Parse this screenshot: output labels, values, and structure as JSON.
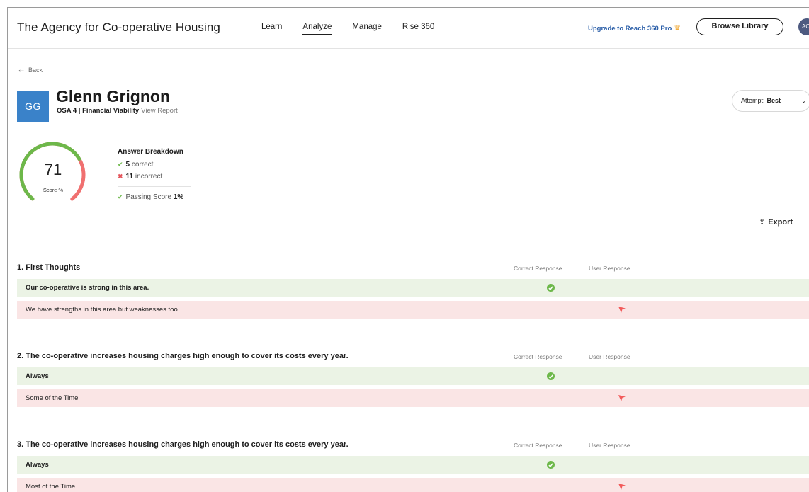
{
  "header": {
    "brand": "The Agency for Co-operative Housing",
    "nav": [
      "Learn",
      "Analyze",
      "Manage",
      "Rise 360"
    ],
    "active_nav": "Analyze",
    "upgrade": "Upgrade to Reach 360 Pro",
    "browse": "Browse Library",
    "avatar": "AC"
  },
  "back": "Back",
  "profile": {
    "initials": "GG",
    "name": "Glenn Grignon",
    "course": "OSA 4 | Financial Viability",
    "view_report": "View Report",
    "attempt_label": "Attempt:",
    "attempt_value": "Best"
  },
  "score": {
    "value": "71",
    "label": "Score %",
    "fraction": 0.71,
    "accent_green": "#6db84a",
    "accent_red": "#f07070"
  },
  "breakdown": {
    "title": "Answer Breakdown",
    "correct_count": "5",
    "correct_label": "correct",
    "incorrect_count": "11",
    "incorrect_label": "incorrect",
    "passing_label": "Passing Score",
    "passing_value": "1%"
  },
  "export": "Export",
  "columns": {
    "correct": "Correct Response",
    "user": "User Response"
  },
  "questions": [
    {
      "title": "1. First Thoughts",
      "correct_answer": "Our co-operative is strong in this area.",
      "user_answer": "We have strengths in this area but weaknesses too."
    },
    {
      "title": "2. The co-operative increases housing charges high enough to cover its costs every year.",
      "correct_answer": "Always",
      "user_answer": "Some of the Time"
    },
    {
      "title": "3. The co-operative increases housing charges high enough to cover its costs every year.",
      "correct_answer": "Always",
      "user_answer": "Most of the Time"
    }
  ]
}
